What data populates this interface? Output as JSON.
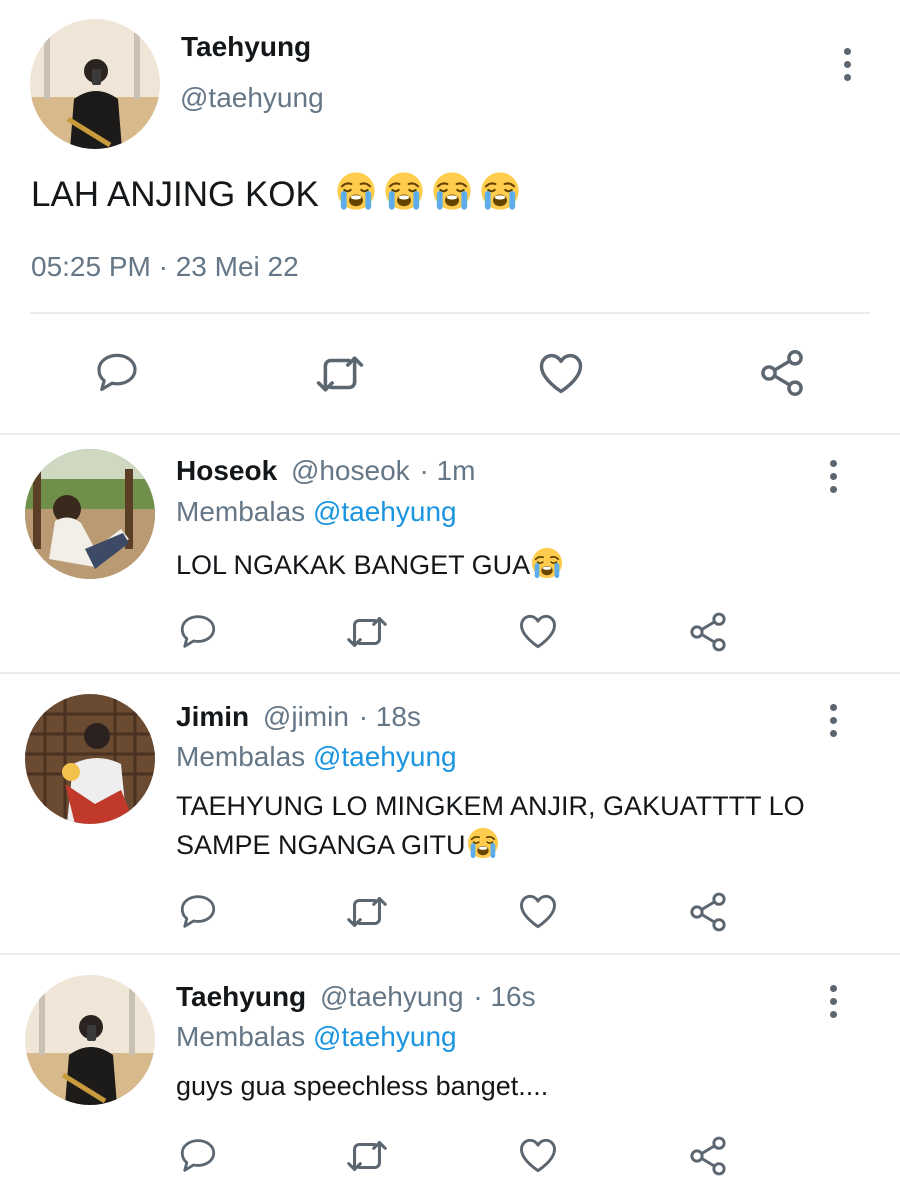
{
  "main_tweet": {
    "name": "Taehyung",
    "handle": "@taehyung",
    "text": "LAH ANJING KOK",
    "emoji_count": 4,
    "timestamp": "05:25 PM · 23 Mei 22"
  },
  "replies": [
    {
      "name": "Hoseok",
      "handle": "@hoseok",
      "time": "· 1m",
      "reply_prefix": "Membalas",
      "reply_to": "@taehyung",
      "text": "LOL NGAKAK BANGET GUA"
    },
    {
      "name": "Jimin",
      "handle": "@jimin",
      "time": "· 18s",
      "reply_prefix": "Membalas",
      "reply_to": "@taehyung",
      "text_line1": "TAEHYUNG LO MINGKEM ANJIR, GAKUATTTT LO",
      "text_line2": "SAMPE NGANGA GITU"
    },
    {
      "name": "Taehyung",
      "handle": "@taehyung",
      "time": "· 16s",
      "reply_prefix": "Membalas",
      "reply_to": "@taehyung",
      "text": "guys gua speechless banget...."
    }
  ],
  "colors": {
    "accent": "#1b95e0",
    "icon": "#5b6670",
    "muted": "#657786",
    "divider": "#e6ecf0"
  },
  "icons": [
    "reply-icon",
    "retweet-icon",
    "like-icon",
    "share-icon",
    "more-icon",
    "loudly-crying-face-emoji"
  ]
}
